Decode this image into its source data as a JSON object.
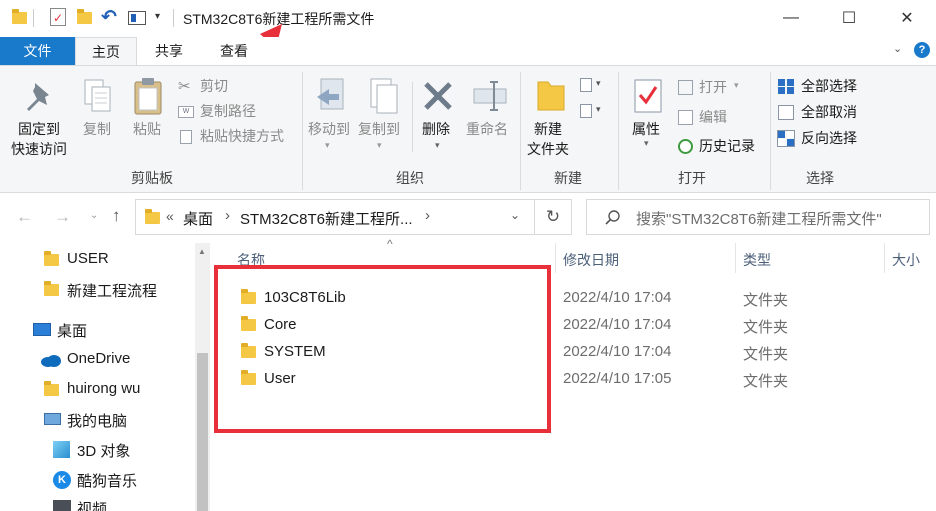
{
  "title": "STM32C8T6新建工程所需文件",
  "window": {
    "minimize": "—",
    "maximize": "☐",
    "close": "✕"
  },
  "tabs": {
    "file": "文件",
    "home": "主页",
    "share": "共享",
    "view": "查看"
  },
  "ribbon": {
    "pin_line1": "固定到",
    "pin_line2": "快速访问",
    "copy": "复制",
    "paste": "粘贴",
    "cut": "剪切",
    "copy_path": "复制路径",
    "paste_shortcut": "粘贴快捷方式",
    "move_to": "移动到",
    "copy_to": "复制到",
    "delete": "删除",
    "rename": "重命名",
    "new_folder_line1": "新建",
    "new_folder_line2": "文件夹",
    "properties": "属性",
    "open": "打开",
    "edit": "编辑",
    "history": "历史记录",
    "select_all": "全部选择",
    "select_none": "全部取消",
    "invert": "反向选择",
    "groups": {
      "clipboard": "剪贴板",
      "organize": "组织",
      "new": "新建",
      "open": "打开",
      "select": "选择"
    }
  },
  "address": {
    "prefix": "«",
    "crumb1": "桌面",
    "sep": "›",
    "crumb2": "STM32C8T6新建工程所...",
    "sep2": "›"
  },
  "search": {
    "placeholder": "搜索\"STM32C8T6新建工程所需文件\""
  },
  "nav": [
    {
      "label": "USER"
    },
    {
      "label": "新建工程流程"
    },
    {
      "label": "桌面"
    },
    {
      "label": "OneDrive"
    },
    {
      "label": "huirong wu"
    },
    {
      "label": "我的电脑"
    },
    {
      "label": "3D 对象"
    },
    {
      "label": "酷狗音乐"
    },
    {
      "label": "视频"
    }
  ],
  "columns": {
    "name": "名称",
    "date": "修改日期",
    "type": "类型",
    "size": "大小"
  },
  "files": [
    {
      "name": "103C8T6Lib",
      "date": "2022/4/10 17:04",
      "type": "文件夹"
    },
    {
      "name": "Core",
      "date": "2022/4/10 17:04",
      "type": "文件夹"
    },
    {
      "name": "SYSTEM",
      "date": "2022/4/10 17:04",
      "type": "文件夹"
    },
    {
      "name": "User",
      "date": "2022/4/10 17:05",
      "type": "文件夹"
    }
  ],
  "colors": {
    "accent": "#1979ca",
    "annotation": "#e8303a",
    "folder": "#f4c745"
  }
}
